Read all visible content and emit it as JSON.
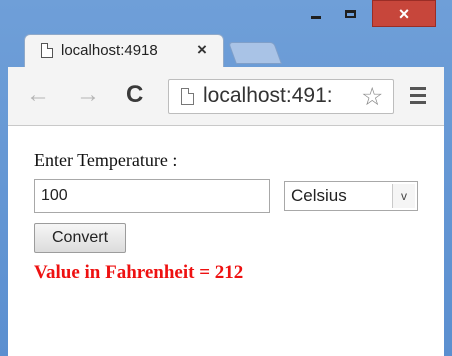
{
  "browser": {
    "tab_title": "localhost:4918",
    "tab_close": "×",
    "address_text": "localhost:491:",
    "nav": {
      "back": "←",
      "forward": "→",
      "reload": "C"
    },
    "window_controls": {
      "close": "×"
    },
    "icons": [
      "page-icon",
      "star-icon",
      "menu-icon",
      "back-arrow-icon",
      "forward-arrow-icon",
      "reload-icon",
      "minimize-icon",
      "maximize-icon",
      "close-icon"
    ]
  },
  "page": {
    "label": "Enter Temperature :",
    "temperature_value": "100",
    "unit_selected": "Celsius",
    "select_arrow": "v",
    "convert_label": "Convert",
    "result_text": "Value in Fahrenheit = 212"
  },
  "colors": {
    "frame": "#5b8fd0",
    "close_button": "#c7463b",
    "result": "#ee1111"
  }
}
